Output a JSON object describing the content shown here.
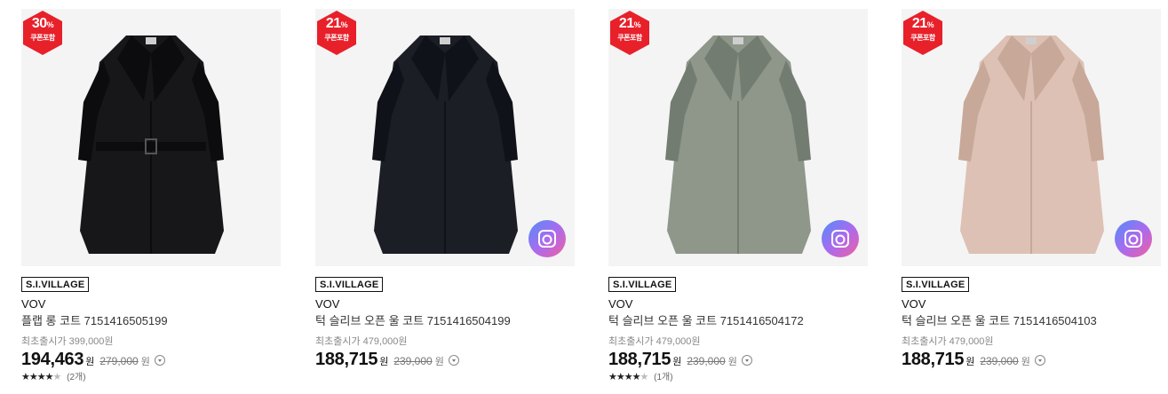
{
  "products": [
    {
      "badge_pct": "30",
      "badge_pct_unit": "%",
      "badge_text": "쿠폰포함",
      "coat_color": "#17171a",
      "coat_shade": "#0c0c0e",
      "has_belt": true,
      "has_camera": false,
      "brand_tag": "S.I.VILLAGE",
      "brand": "VOV",
      "name": "플랩 롱 코트 7151416505199",
      "original_price": "최초출시가 399,000원",
      "sale_price": "194,463",
      "won": "원",
      "list_price": "279,000",
      "list_won": "원",
      "stars": 4,
      "rating_count": "(2개)"
    },
    {
      "badge_pct": "21",
      "badge_pct_unit": "%",
      "badge_text": "쿠폰포함",
      "coat_color": "#1c1e26",
      "coat_shade": "#101219",
      "has_belt": false,
      "has_camera": true,
      "camera_icon": "camera-icon",
      "brand_tag": "S.I.VILLAGE",
      "brand": "VOV",
      "name": "턱 슬리브 오픈 울 코트 7151416504199",
      "original_price": "최초출시가 479,000원",
      "sale_price": "188,715",
      "won": "원",
      "list_price": "239,000",
      "list_won": "원",
      "stars": null,
      "rating_count": null
    },
    {
      "badge_pct": "21",
      "badge_pct_unit": "%",
      "badge_text": "쿠폰포함",
      "coat_color": "#8e978a",
      "coat_shade": "#737c70",
      "has_belt": false,
      "has_camera": true,
      "camera_icon": "camera-icon",
      "brand_tag": "S.I.VILLAGE",
      "brand": "VOV",
      "name": "턱 슬리브 오픈 울 코트 7151416504172",
      "original_price": "최초출시가 479,000원",
      "sale_price": "188,715",
      "won": "원",
      "list_price": "239,000",
      "list_won": "원",
      "stars": 4,
      "rating_count": "(1개)"
    },
    {
      "badge_pct": "21",
      "badge_pct_unit": "%",
      "badge_text": "쿠폰포함",
      "coat_color": "#ddc1b4",
      "coat_shade": "#c8a898",
      "has_belt": false,
      "has_camera": true,
      "camera_icon": "camera-icon",
      "brand_tag": "S.I.VILLAGE",
      "brand": "VOV",
      "name": "턱 슬리브 오픈 울 코트 7151416504103",
      "original_price": "최초출시가 479,000원",
      "sale_price": "188,715",
      "won": "원",
      "list_price": "239,000",
      "list_won": "원",
      "stars": null,
      "rating_count": null
    }
  ],
  "colors": {
    "badge_red": "#e8202a",
    "text_primary": "#111111",
    "text_muted": "#888888",
    "thumb_bg": "#f4f4f4"
  }
}
